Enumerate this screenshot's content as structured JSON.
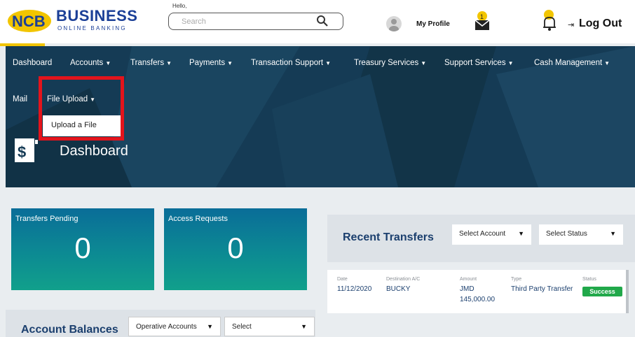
{
  "header": {
    "brand_title": "BUSINESS",
    "brand_subtitle": "ONLINE BANKING",
    "greeting": "Hello,",
    "search_placeholder": "Search",
    "profile_label": "My Profile",
    "logout_label": "Log Out",
    "notification_count": "1"
  },
  "nav": {
    "items": [
      "Dashboard",
      "Accounts",
      "Transfers",
      "Payments",
      "Transaction Support",
      "Treasury Services",
      "Support Services",
      "Cash Management",
      "Mail",
      "File Upload"
    ],
    "dropdown_item": "Upload a File"
  },
  "page": {
    "title": "Dashboard"
  },
  "cards": [
    {
      "label": "Transfers Pending",
      "count": "0"
    },
    {
      "label": "Access Requests",
      "count": "0"
    }
  ],
  "account_balances": {
    "title": "Account Balances",
    "filter1": "Operative Accounts",
    "filter2": "Select"
  },
  "recent_transfers": {
    "title": "Recent Transfers",
    "select_account": "Select Account",
    "select_status": "Select Status",
    "columns": [
      "Date",
      "Destination A/C",
      "Amount",
      "Type",
      "Status"
    ],
    "row": {
      "date": "11/12/2020",
      "destination": "BUCKY",
      "amount_currency": "JMD",
      "amount_value": "145,000.00",
      "type": "Third Party Transfer",
      "status": "Success"
    }
  },
  "colors": {
    "brand_blue": "#1b3f97",
    "banner_navy": "#153b55",
    "highlight_red": "#e3141c",
    "success_green": "#21a84a",
    "accent_yellow": "#f2c500"
  }
}
